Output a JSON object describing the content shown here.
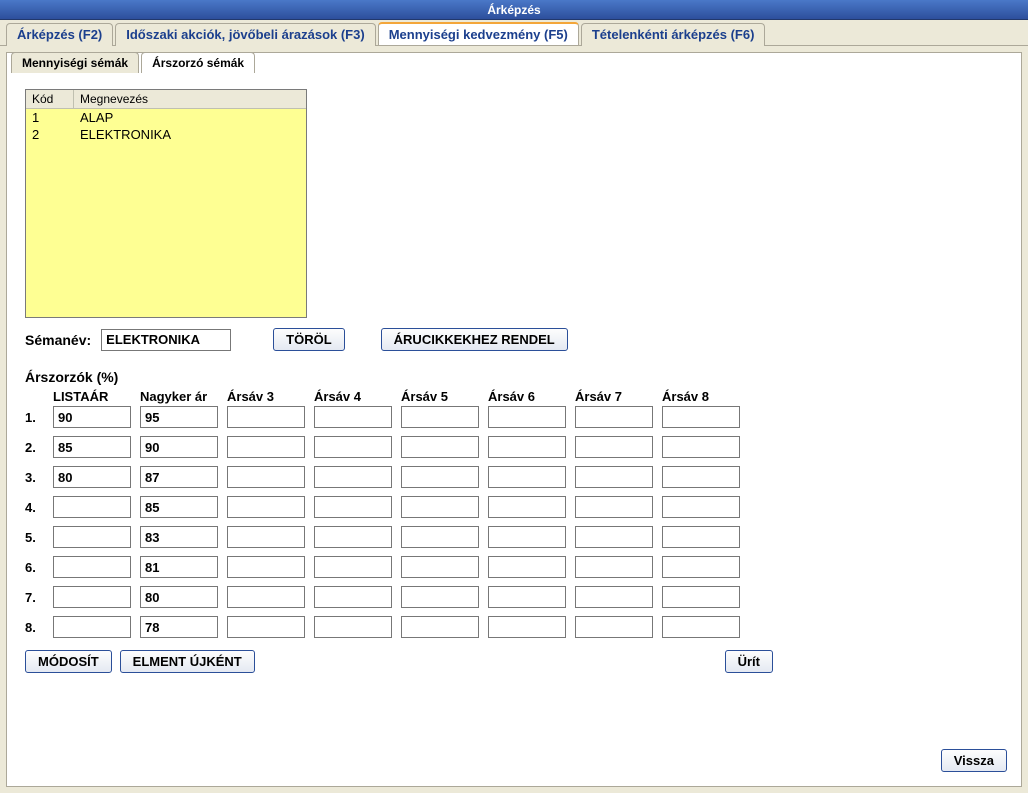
{
  "title": "Árképzés",
  "outerTabs": [
    "Árképzés (F2)",
    "Időszaki akciók, jövőbeli árazások (F3)",
    "Mennyiségi kedvezmény (F5)",
    "Tételenkénti árképzés (F6)"
  ],
  "outerActive": 2,
  "innerTabs": [
    "Mennyiségi sémák",
    "Árszorzó sémák"
  ],
  "innerActive": 1,
  "list": {
    "headers": {
      "code": "Kód",
      "name": "Megnevezés"
    },
    "rows": [
      {
        "code": "1",
        "name": "ALAP"
      },
      {
        "code": "2",
        "name": "ELEKTRONIKA"
      }
    ]
  },
  "schemaLabel": "Sémanév:",
  "schemaValue": "ELEKTRONIKA",
  "buttons": {
    "delete": "TÖRÖL",
    "assign": "ÁRUCIKKEKHEZ RENDEL",
    "modify": "MÓDOSÍT",
    "saveAs": "ELMENT ÚJKÉNT",
    "clear": "Ürít",
    "back": "Vissza"
  },
  "multLabel": "Árszorzók (%)",
  "multHeaders": [
    "LISTAÁR",
    "Nagyker ár",
    "Ársáv 3",
    "Ársáv 4",
    "Ársáv 5",
    "Ársáv 6",
    "Ársáv 7",
    "Ársáv 8"
  ],
  "multRows": [
    {
      "n": "1.",
      "v": [
        "90",
        "95",
        "",
        "",
        "",
        "",
        "",
        ""
      ]
    },
    {
      "n": "2.",
      "v": [
        "85",
        "90",
        "",
        "",
        "",
        "",
        "",
        ""
      ]
    },
    {
      "n": "3.",
      "v": [
        "80",
        "87",
        "",
        "",
        "",
        "",
        "",
        ""
      ]
    },
    {
      "n": "4.",
      "v": [
        "",
        "85",
        "",
        "",
        "",
        "",
        "",
        ""
      ]
    },
    {
      "n": "5.",
      "v": [
        "",
        "83",
        "",
        "",
        "",
        "",
        "",
        ""
      ]
    },
    {
      "n": "6.",
      "v": [
        "",
        "81",
        "",
        "",
        "",
        "",
        "",
        ""
      ]
    },
    {
      "n": "7.",
      "v": [
        "",
        "80",
        "",
        "",
        "",
        "",
        "",
        ""
      ]
    },
    {
      "n": "8.",
      "v": [
        "",
        "78",
        "",
        "",
        "",
        "",
        "",
        ""
      ]
    }
  ]
}
